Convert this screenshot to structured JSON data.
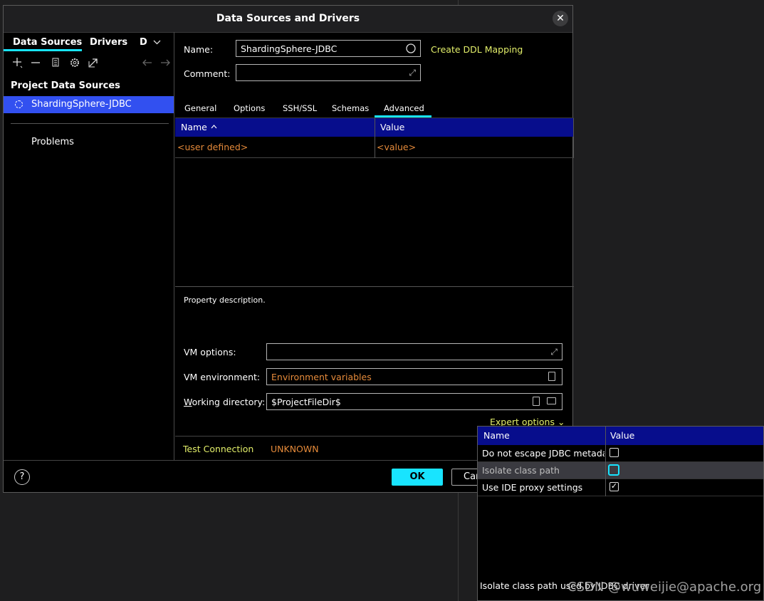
{
  "dialog": {
    "title": "Data Sources and Drivers",
    "close_glyph": "✕"
  },
  "left": {
    "tabs": [
      "Data Sources",
      "Drivers",
      "D"
    ],
    "section_header": "Project Data Sources",
    "selected_item": "ShardingSphere-JDBC",
    "problems_label": "Problems"
  },
  "form": {
    "name_label": "Name:",
    "name_value": "ShardingSphere-JDBC",
    "create_ddl_link": "Create DDL Mapping",
    "comment_label": "Comment:",
    "comment_value": ""
  },
  "tabs": [
    {
      "label": "General",
      "active": false
    },
    {
      "label": "Options",
      "active": false
    },
    {
      "label": "SSH/SSL",
      "active": false
    },
    {
      "label": "Schemas",
      "active": false
    },
    {
      "label": "Advanced",
      "active": true
    }
  ],
  "grid": {
    "columns": [
      "Name",
      "Value"
    ],
    "sort_indicator": "^",
    "rows": [
      {
        "name": "<user defined>",
        "value": "<value>"
      }
    ]
  },
  "property_description": "Property description.",
  "vm": {
    "options_label": "VM options:",
    "options_value": "",
    "env_label": "VM environment:",
    "env_placeholder": "Environment variables",
    "workdir_label_underlined": "W",
    "workdir_label_rest": "orking directory:",
    "workdir_value": "$ProjectFileDir$"
  },
  "expert_options": "Expert options",
  "test_connection": "Test Connection",
  "status": "UNKNOWN",
  "footer": {
    "help": "?",
    "ok": "OK",
    "cancel": "Can"
  },
  "popup": {
    "columns": [
      "Name",
      "Value"
    ],
    "rows": [
      {
        "name": "Do not escape JDBC metadat",
        "checked": false,
        "highlight": false
      },
      {
        "name": "Isolate class path",
        "checked": false,
        "highlight": true
      },
      {
        "name": "Use IDE proxy settings",
        "checked": true,
        "highlight": false
      }
    ],
    "description": "Isolate class path used by JDBC driver"
  },
  "watermark": "CSDN @wuweijie@apache.org",
  "colors": {
    "accent_cyan": "#18e4ff",
    "selection_blue": "#3250f0",
    "header_navy": "#070d8c",
    "link_yellow": "#e3ef6a",
    "orange": "#e58a3a"
  }
}
